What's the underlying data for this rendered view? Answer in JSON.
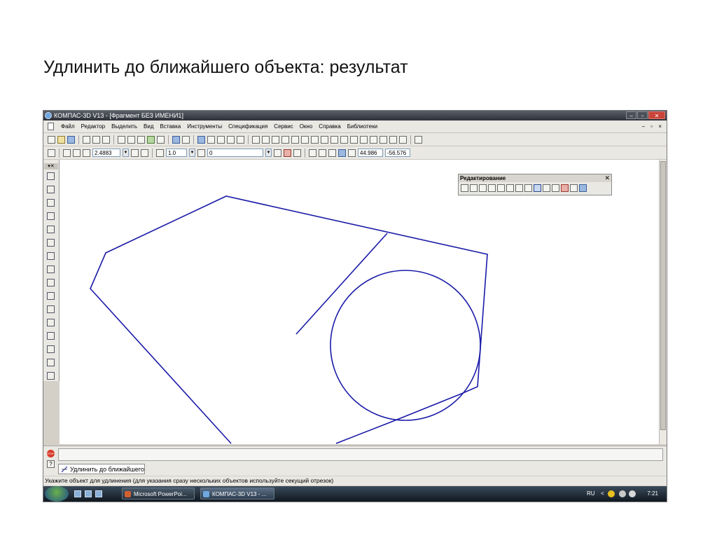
{
  "slide": {
    "title": "Удлинить до  ближайшего объекта: результат"
  },
  "window": {
    "title": "КОМПАС-3D V13 - [Фрагмент БЕЗ ИМЕНИ1]",
    "buttons": {
      "minimize": "–",
      "restore": "▫",
      "close": "✕"
    }
  },
  "menu": {
    "items": [
      "Файл",
      "Редактор",
      "Выделить",
      "Вид",
      "Вставка",
      "Инструменты",
      "Спецификация",
      "Сервис",
      "Окно",
      "Справка",
      "Библиотеки"
    ],
    "mdi_controls": "– ▫ ×"
  },
  "toolbar2": {
    "zoom_value": "2.4883",
    "step_value": "1.0",
    "layer_value": "0",
    "coord_x": "44.986",
    "coord_y": "-56.576"
  },
  "compact_panel": {
    "header": "▾✕"
  },
  "edit_panel": {
    "title": "Редактирование",
    "close": "✕",
    "icon_count": 15,
    "active_icon_index": 8
  },
  "command": {
    "tab_label": "Удлинить до ближайшего",
    "stop_label": "STOP",
    "help_label": "?"
  },
  "status": {
    "hint": "Укажите объект для удлинения (для указания сразу нескольких объектов используйте секущий отрезок)"
  },
  "taskbar": {
    "tasks": [
      "Microsoft PowerPoi...",
      "КОМПАС-3D V13 - ..."
    ],
    "language": "RU",
    "tray_arrow": "<",
    "clock": "7:21"
  },
  "colors": {
    "geometry": "#1a1aa8",
    "title_bar": "#2d3038",
    "taskbar": "#101820"
  }
}
